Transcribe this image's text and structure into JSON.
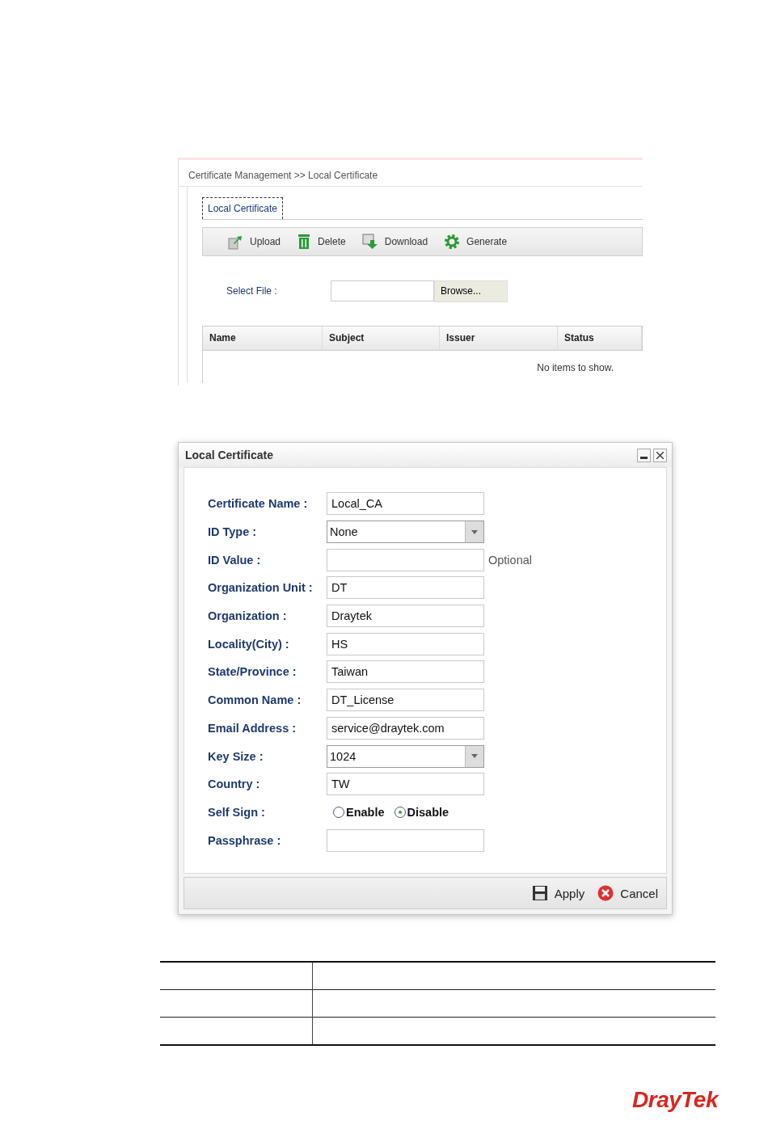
{
  "page": {
    "breadcrumb": "Certificate Management >> Local Certificate",
    "tabs": [
      {
        "label": "Local Certificate",
        "selected": true
      }
    ],
    "toolbar": [
      {
        "kind": "upload",
        "label": "Upload"
      },
      {
        "kind": "delete",
        "label": "Delete"
      },
      {
        "kind": "download",
        "label": "Download"
      },
      {
        "kind": "generate",
        "label": "Generate"
      }
    ],
    "select_file": {
      "label": "Select File :",
      "button": "Browse..."
    },
    "table": {
      "columns": [
        "Name",
        "Subject",
        "Issuer",
        "Status"
      ],
      "empty_text": "No items to show."
    }
  },
  "dialog": {
    "title": "Local Certificate",
    "fields": [
      {
        "kind": "text",
        "label": "Certificate Name :",
        "value": "Local_CA"
      },
      {
        "kind": "select",
        "label": "ID Type :",
        "value": "None"
      },
      {
        "kind": "text",
        "label": "ID Value :",
        "note": "Optional"
      },
      {
        "kind": "text",
        "label": "Organization Unit :",
        "value": "DT"
      },
      {
        "kind": "text",
        "label": "Organization :",
        "value": "Draytek"
      },
      {
        "kind": "text",
        "label": "Locality(City) :",
        "value": "HS"
      },
      {
        "kind": "text",
        "label": "State/Province :",
        "value": "Taiwan"
      },
      {
        "kind": "text",
        "label": "Common Name :",
        "value": "DT_License"
      },
      {
        "kind": "text",
        "label": "Email Address :",
        "value": "service@draytek.com"
      },
      {
        "kind": "select",
        "label": "Key Size :",
        "value": "1024"
      },
      {
        "kind": "text",
        "label": "Country :",
        "value": "TW"
      },
      {
        "kind": "radio",
        "label": "Self Sign :",
        "options": [
          {
            "label": "Enable",
            "selected": false
          },
          {
            "label": "Disable",
            "selected": true
          }
        ]
      },
      {
        "kind": "text",
        "label": "Passphrase :"
      }
    ],
    "buttons": [
      {
        "kind": "apply",
        "label": "Apply"
      },
      {
        "kind": "cancel",
        "label": "Cancel"
      }
    ]
  },
  "logo": {
    "text": "DrayTek"
  }
}
